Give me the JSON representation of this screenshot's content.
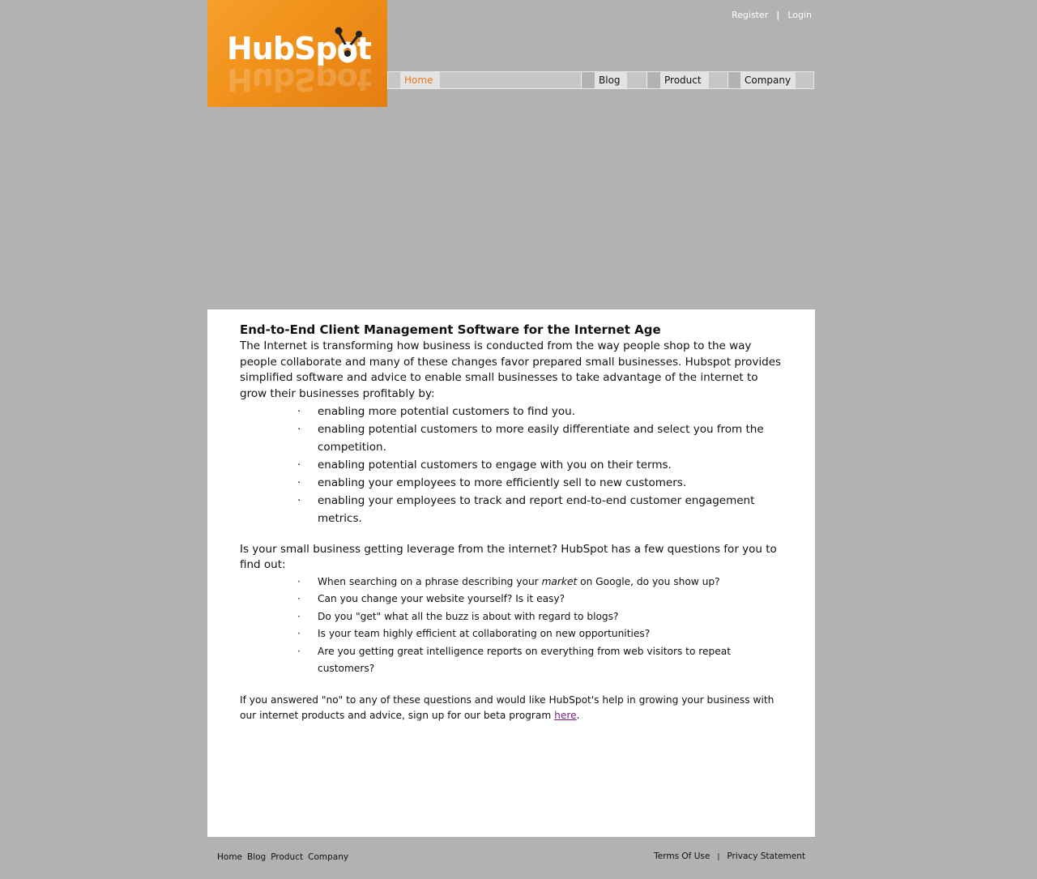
{
  "logo": {
    "text": "HubSpot"
  },
  "top_links": {
    "register": "Register",
    "separator": "|",
    "login": "Login"
  },
  "nav": {
    "tabs": [
      {
        "label": "Home"
      },
      {
        "label": "Blog"
      },
      {
        "label": "Product"
      },
      {
        "label": "Company"
      }
    ]
  },
  "content": {
    "heading": "End-to-End Client Management Software for the Internet Age",
    "intro": "The Internet is transforming how business is conducted from the way people shop to the way people collaborate and many of these changes favor prepared small businesses.  Hubspot provides simplified software and advice to enable small businesses to take advantage of the internet to grow their businesses profitably by:",
    "benefits": [
      "enabling more potential customers to find you.",
      "enabling potential customers to more easily differentiate and select you from the competition.",
      "enabling potential customers to engage with you on their terms.",
      "enabling your employees to more efficiently sell to new customers.",
      "enabling your employees to track and report end-to-end customer engagement metrics."
    ],
    "question_intro": "Is your small business getting leverage from the internet?  HubSpot has a few questions for you to find out:",
    "question1_before": "When searching on a phrase describing your ",
    "question1_emphasis": "market",
    "question1_after": " on Google, do you show up?",
    "questions_rest": [
      "Can you change your website yourself?  Is it easy?",
      "Do you \"get\" what all the buzz is about with regard to blogs?",
      "Is your team highly efficient at collaborating on new opportunities?",
      "Are you getting great intelligence reports on everything from web visitors to repeat customers?"
    ],
    "closing_text": "If you answered \"no\" to any of these questions and would like HubSpot's help in growing your business with our internet products and advice, sign up for our beta program ",
    "closing_link": "here",
    "closing_end": "."
  },
  "footer": {
    "links": [
      "Home",
      "Blog",
      "Product",
      "Company"
    ],
    "terms": "Terms Of Use",
    "separator": "|",
    "privacy": "Privacy Statement"
  },
  "colors": {
    "background": "#b2b2b2",
    "logo_orange": "#f0901a",
    "active_tab": "#e57a1a",
    "visited_link": "#7a1f7a"
  }
}
